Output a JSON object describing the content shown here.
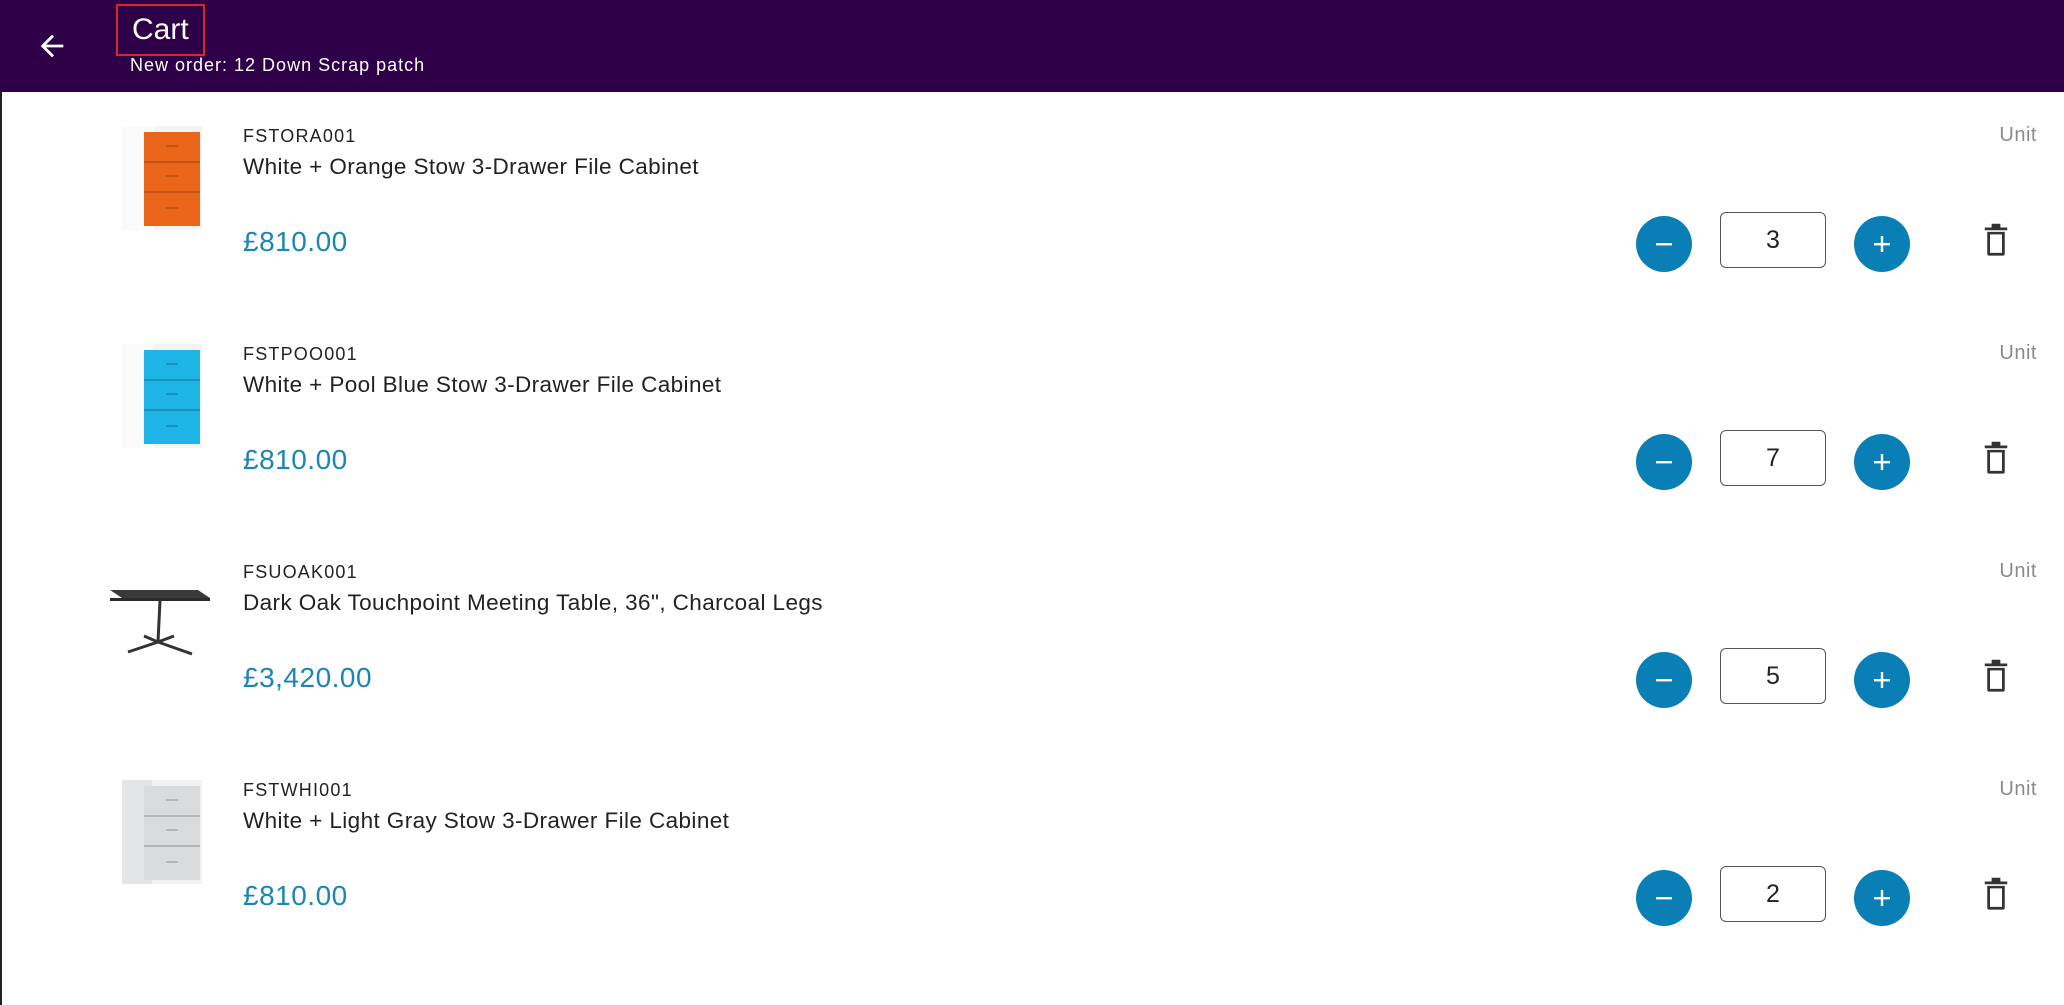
{
  "header": {
    "title": "Cart",
    "subtitle": "New order: 12 Down Scrap patch",
    "background": "#2e0047",
    "back_icon": "arrow-left-icon"
  },
  "accent_color": "#0a7fb6",
  "price_color": "#1a86b4",
  "cart": {
    "items": [
      {
        "sku": "FSTORA001",
        "name": "White + Orange Stow 3-Drawer File Cabinet",
        "price": "£810.00",
        "unit": "Unit",
        "quantity": "3",
        "image": "orange-file-cabinet-image",
        "color": "#e8651a"
      },
      {
        "sku": "FSTPOO001",
        "name": "White + Pool Blue Stow 3-Drawer File Cabinet",
        "price": "£810.00",
        "unit": "Unit",
        "quantity": "7",
        "image": "blue-file-cabinet-image",
        "color": "#1fb5e6"
      },
      {
        "sku": "FSUOAK001",
        "name": "Dark Oak Touchpoint Meeting Table, 36\", Charcoal Legs",
        "price": "£3,420.00",
        "unit": "Unit",
        "quantity": "5",
        "image": "meeting-table-image",
        "color": "#3a3a3a"
      },
      {
        "sku": "FSTWHI001",
        "name": "White + Light Gray Stow 3-Drawer File Cabinet",
        "price": "£810.00",
        "unit": "Unit",
        "quantity": "2",
        "image": "gray-file-cabinet-image",
        "color": "#d9dbdd"
      }
    ]
  }
}
